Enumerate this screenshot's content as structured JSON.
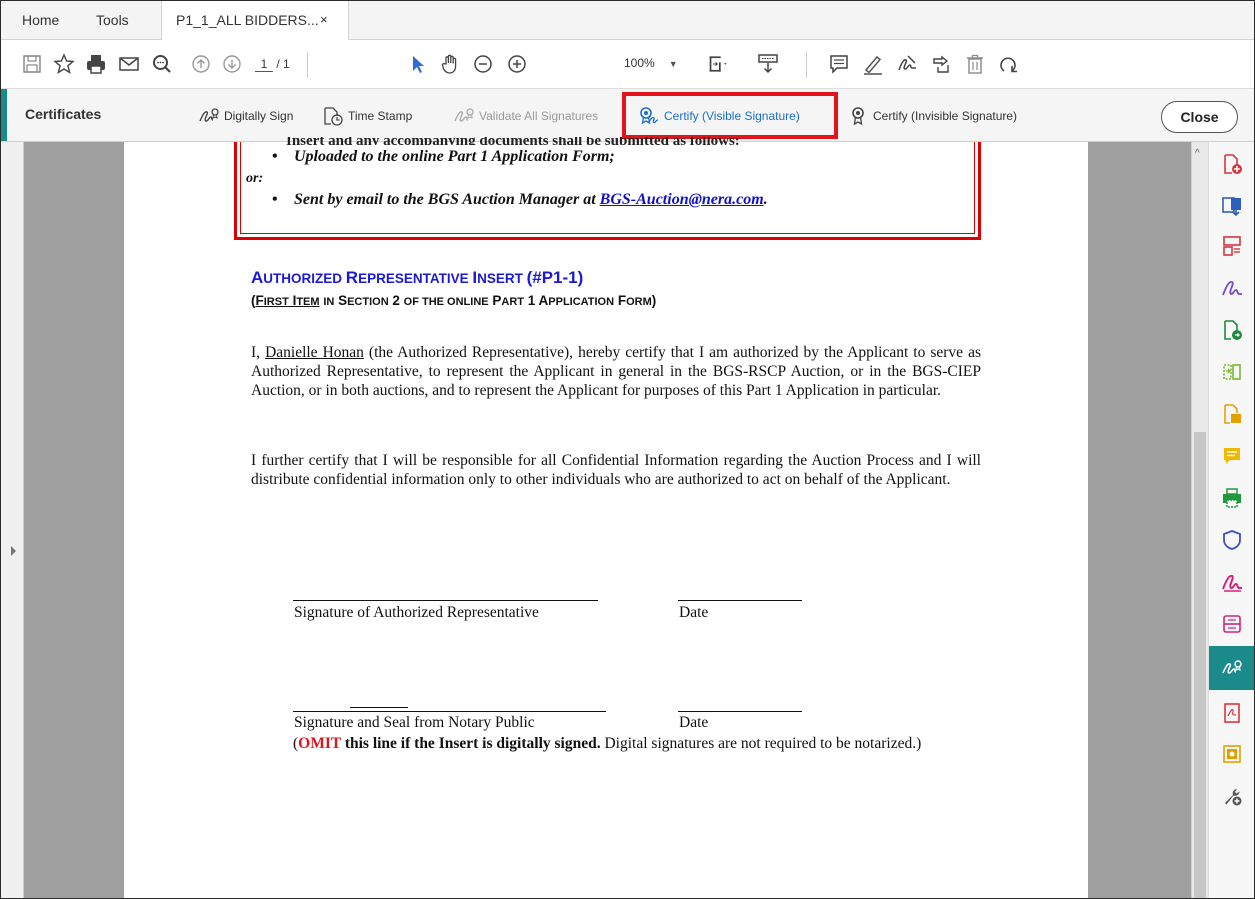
{
  "tabs": {
    "home": "Home",
    "tools": "Tools",
    "document": "P1_1_ALL BIDDERS...",
    "close_symbol": "×"
  },
  "toolbar": {
    "page_current": "1",
    "page_total": "/ 1",
    "zoom": "100%"
  },
  "certificates_bar": {
    "title": "Certificates",
    "digitally_sign": "Digitally Sign",
    "time_stamp": "Time Stamp",
    "validate_all": "Validate All Signatures",
    "certify_visible": "Certify (Visible Signature)",
    "certify_invisible": "Certify (Invisible Signature)",
    "close": "Close"
  },
  "document": {
    "cut_line": "Insert and any accompanying documents shall be submitted as follows:",
    "bullet1": "Uploaded to the online Part 1 Application Form;",
    "or": "or:",
    "bullet2_prefix": "Sent by email to the BGS Auction Manager at ",
    "bullet2_email": "BGS-Auction@nera.com",
    "bullet2_suffix": ".",
    "heading_main_a": "A",
    "heading_main_b": "UTHORIZED ",
    "heading_main_c": "R",
    "heading_main_d": "EPRESENTATIVE ",
    "heading_main_e": "I",
    "heading_main_f": "NSERT ",
    "heading_main_g": "(#P1-1)",
    "heading_sub": "(First Item in Section 2 of the online Part 1 Application Form)",
    "para1_name": "Danielle Honan",
    "para1_pre": "I, ",
    "para1_post": " (the Authorized Representative), hereby certify that I am authorized by the Applicant to serve as Authorized Representative, to represent the Applicant in general in the BGS-RSCP Auction, or in the BGS-CIEP Auction, or in both auctions, and to represent the Applicant for purposes of this Part 1 Application in particular.",
    "para2": "I further certify that I will be responsible for all Confidential Information regarding the Auction Process and I will distribute confidential information only to other individuals who are authorized to act on behalf of the Applicant.",
    "sig1_label": "Signature of Authorized Representative",
    "date1_label": "Date",
    "sig2_label": "Signature and Seal from Notary Public",
    "date2_label": "Date",
    "omit_open": "(",
    "omit_word": "OMIT",
    "omit_bold": " this line if the Insert is digitally signed.",
    "omit_rest": " Digital signatures are not required to be notarized.)"
  },
  "colors": {
    "accent": "#1b8a8a",
    "highlight": "#e4131b",
    "link": "#1010d0",
    "heading": "#1a1ad6"
  },
  "right_rail_icons": [
    "create-pdf-icon",
    "export-pdf-icon",
    "organize-pages-icon",
    "fill-sign-icon",
    "edit-pdf-icon",
    "compare-icon",
    "combine-files-icon",
    "comment-icon",
    "print-production-icon",
    "protect-icon",
    "send-for-signature-icon",
    "scan-icon",
    "certificates-icon",
    "pdf-standards-icon",
    "action-wizard-icon",
    "more-tools-icon"
  ]
}
